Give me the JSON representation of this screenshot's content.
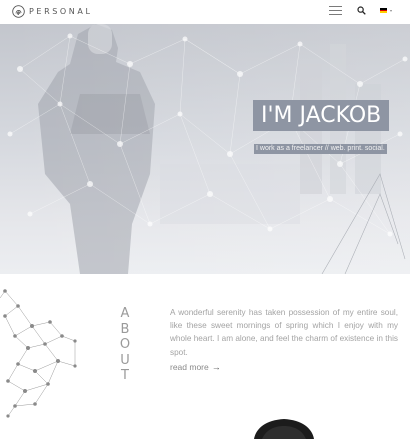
{
  "header": {
    "logo_text": "PERSONAL",
    "logo_icon": "fingerprint-icon",
    "menu_icon": "hamburger-menu-icon",
    "search_icon": "search-icon",
    "language": {
      "icon": "german-flag-icon",
      "caret": "▾"
    }
  },
  "hero": {
    "title": "I'M JACKOB",
    "subtitle": "I work as a freelancer // web. print. social."
  },
  "about": {
    "vertical_title": [
      "A",
      "B",
      "O",
      "U",
      "T"
    ],
    "text": "A wonderful serenity has taken possession of my entire soul, like these sweet mornings of spring which I enjoy with my whole heart. I am alone, and feel the charm of existence in this spot.",
    "read_more": "read more",
    "read_more_arrow": "→"
  },
  "colors": {
    "accent_box": "#8e95a3",
    "text_muted": "#a3a3a3"
  }
}
